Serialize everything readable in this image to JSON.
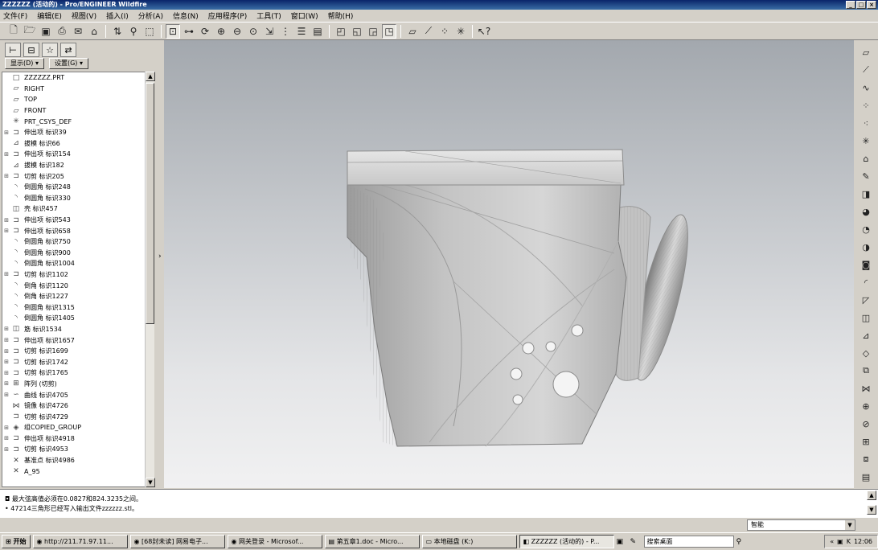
{
  "window": {
    "title": "ZZZZZZ (活动的) - Pro/ENGINEER Wildfire",
    "controls": [
      "_",
      "□",
      "×"
    ]
  },
  "menu": [
    "文件(F)",
    "编辑(E)",
    "视图(V)",
    "插入(I)",
    "分析(A)",
    "信息(N)",
    "应用程序(P)",
    "工具(T)",
    "窗口(W)",
    "帮助(H)"
  ],
  "left_panel": {
    "display_label": "显示(D) ▾",
    "settings_label": "设置(G) ▾",
    "tree": [
      {
        "exp": "",
        "icon": "part-icon",
        "glyph": "□",
        "label": "ZZZZZZ.PRT"
      },
      {
        "exp": "",
        "icon": "datum-plane-icon",
        "glyph": "▱",
        "label": "RIGHT"
      },
      {
        "exp": "",
        "icon": "datum-plane-icon",
        "glyph": "▱",
        "label": "TOP"
      },
      {
        "exp": "",
        "icon": "datum-plane-icon",
        "glyph": "▱",
        "label": "FRONT"
      },
      {
        "exp": "",
        "icon": "csys-icon",
        "glyph": "✳",
        "label": "PRT_CSYS_DEF"
      },
      {
        "exp": "⊞",
        "icon": "extrude-icon",
        "glyph": "⊐",
        "label": "伸出项 标识39"
      },
      {
        "exp": "",
        "icon": "draft-icon",
        "glyph": "⊿",
        "label": "拔模 标识66"
      },
      {
        "exp": "⊞",
        "icon": "extrude-icon",
        "glyph": "⊐",
        "label": "伸出项 标识154"
      },
      {
        "exp": "",
        "icon": "draft-icon",
        "glyph": "⊿",
        "label": "拔模 标识182"
      },
      {
        "exp": "⊞",
        "icon": "cut-icon",
        "glyph": "⊐",
        "label": "切剪 标识205"
      },
      {
        "exp": "",
        "icon": "round-icon",
        "glyph": "◝",
        "label": "倒圆角 标识248"
      },
      {
        "exp": "",
        "icon": "round-icon",
        "glyph": "◝",
        "label": "倒圆角 标识330"
      },
      {
        "exp": "",
        "icon": "shell-icon",
        "glyph": "◫",
        "label": "壳 标识457"
      },
      {
        "exp": "⊞",
        "icon": "extrude-icon",
        "glyph": "⊐",
        "label": "伸出项 标识543"
      },
      {
        "exp": "⊞",
        "icon": "extrude-icon",
        "glyph": "⊐",
        "label": "伸出项 标识658"
      },
      {
        "exp": "",
        "icon": "round-icon",
        "glyph": "◝",
        "label": "倒圆角 标识750"
      },
      {
        "exp": "",
        "icon": "round-icon",
        "glyph": "◝",
        "label": "倒圆角 标识900"
      },
      {
        "exp": "",
        "icon": "round-icon",
        "glyph": "◝",
        "label": "倒圆角 标识1004"
      },
      {
        "exp": "⊞",
        "icon": "cut-icon",
        "glyph": "⊐",
        "label": "切剪 标识1102"
      },
      {
        "exp": "",
        "icon": "chamfer-icon",
        "glyph": "◝",
        "label": "倒角 标识1120"
      },
      {
        "exp": "",
        "icon": "chamfer-icon",
        "glyph": "◝",
        "label": "倒角 标识1227"
      },
      {
        "exp": "",
        "icon": "round-icon",
        "glyph": "◝",
        "label": "倒圆角 标识1315"
      },
      {
        "exp": "",
        "icon": "round-icon",
        "glyph": "◝",
        "label": "倒圆角 标识1405"
      },
      {
        "exp": "⊞",
        "icon": "rib-icon",
        "glyph": "◫",
        "label": "筋 标识1534"
      },
      {
        "exp": "⊞",
        "icon": "extrude-icon",
        "glyph": "⊐",
        "label": "伸出项 标识1657"
      },
      {
        "exp": "⊞",
        "icon": "cut-icon",
        "glyph": "⊐",
        "label": "切剪 标识1699"
      },
      {
        "exp": "⊞",
        "icon": "cut-icon",
        "glyph": "⊐",
        "label": "切剪 标识1742"
      },
      {
        "exp": "⊞",
        "icon": "cut-icon",
        "glyph": "⊐",
        "label": "切剪 标识1765"
      },
      {
        "exp": "⊞",
        "icon": "pattern-icon",
        "glyph": "⊞",
        "label": "阵列 (切剪)"
      },
      {
        "exp": "⊞",
        "icon": "curve-icon",
        "glyph": "∽",
        "label": "曲线 标识4705"
      },
      {
        "exp": "",
        "icon": "mirror-icon",
        "glyph": "⋈",
        "label": "镜像 标识4726"
      },
      {
        "exp": "",
        "icon": "cut-icon",
        "glyph": "⊐",
        "label": "切剪 标识4729"
      },
      {
        "exp": "⊞",
        "icon": "group-icon",
        "glyph": "◈",
        "label": "组COPIED_GROUP"
      },
      {
        "exp": "⊞",
        "icon": "extrude-icon",
        "glyph": "⊐",
        "label": "伸出项 标识4918"
      },
      {
        "exp": "⊞",
        "icon": "cut-icon",
        "glyph": "⊐",
        "label": "切剪 标识4953"
      },
      {
        "exp": "",
        "icon": "datum-point-icon",
        "glyph": "✕",
        "label": "基准点 标识4986"
      },
      {
        "exp": "",
        "icon": "datum-point-icon",
        "glyph": "✕",
        "label": "A_95"
      }
    ]
  },
  "messages": [
    "◘ 最大弦高值必须在0.0827和824.3235之间。",
    "• 47214三角形已经写入输出文件zzzzzz.stl。"
  ],
  "filter": "智能",
  "taskbar": {
    "start": "开始",
    "tasks": [
      "http://211.71.97.11...",
      "[68封未读] 网易电子...",
      "网关登录 - Microsof...",
      "第五章1.doc - Micro...",
      "本地磁盘 (K:)",
      "ZZZZZZ (活动的) - P..."
    ],
    "search_placeholder": "搜索桌面",
    "clock": "12:06"
  },
  "colors": {
    "viewport_top": "#a3a8ae",
    "viewport_bottom": "#f1f1f2",
    "title_blue": "#0a246a"
  }
}
